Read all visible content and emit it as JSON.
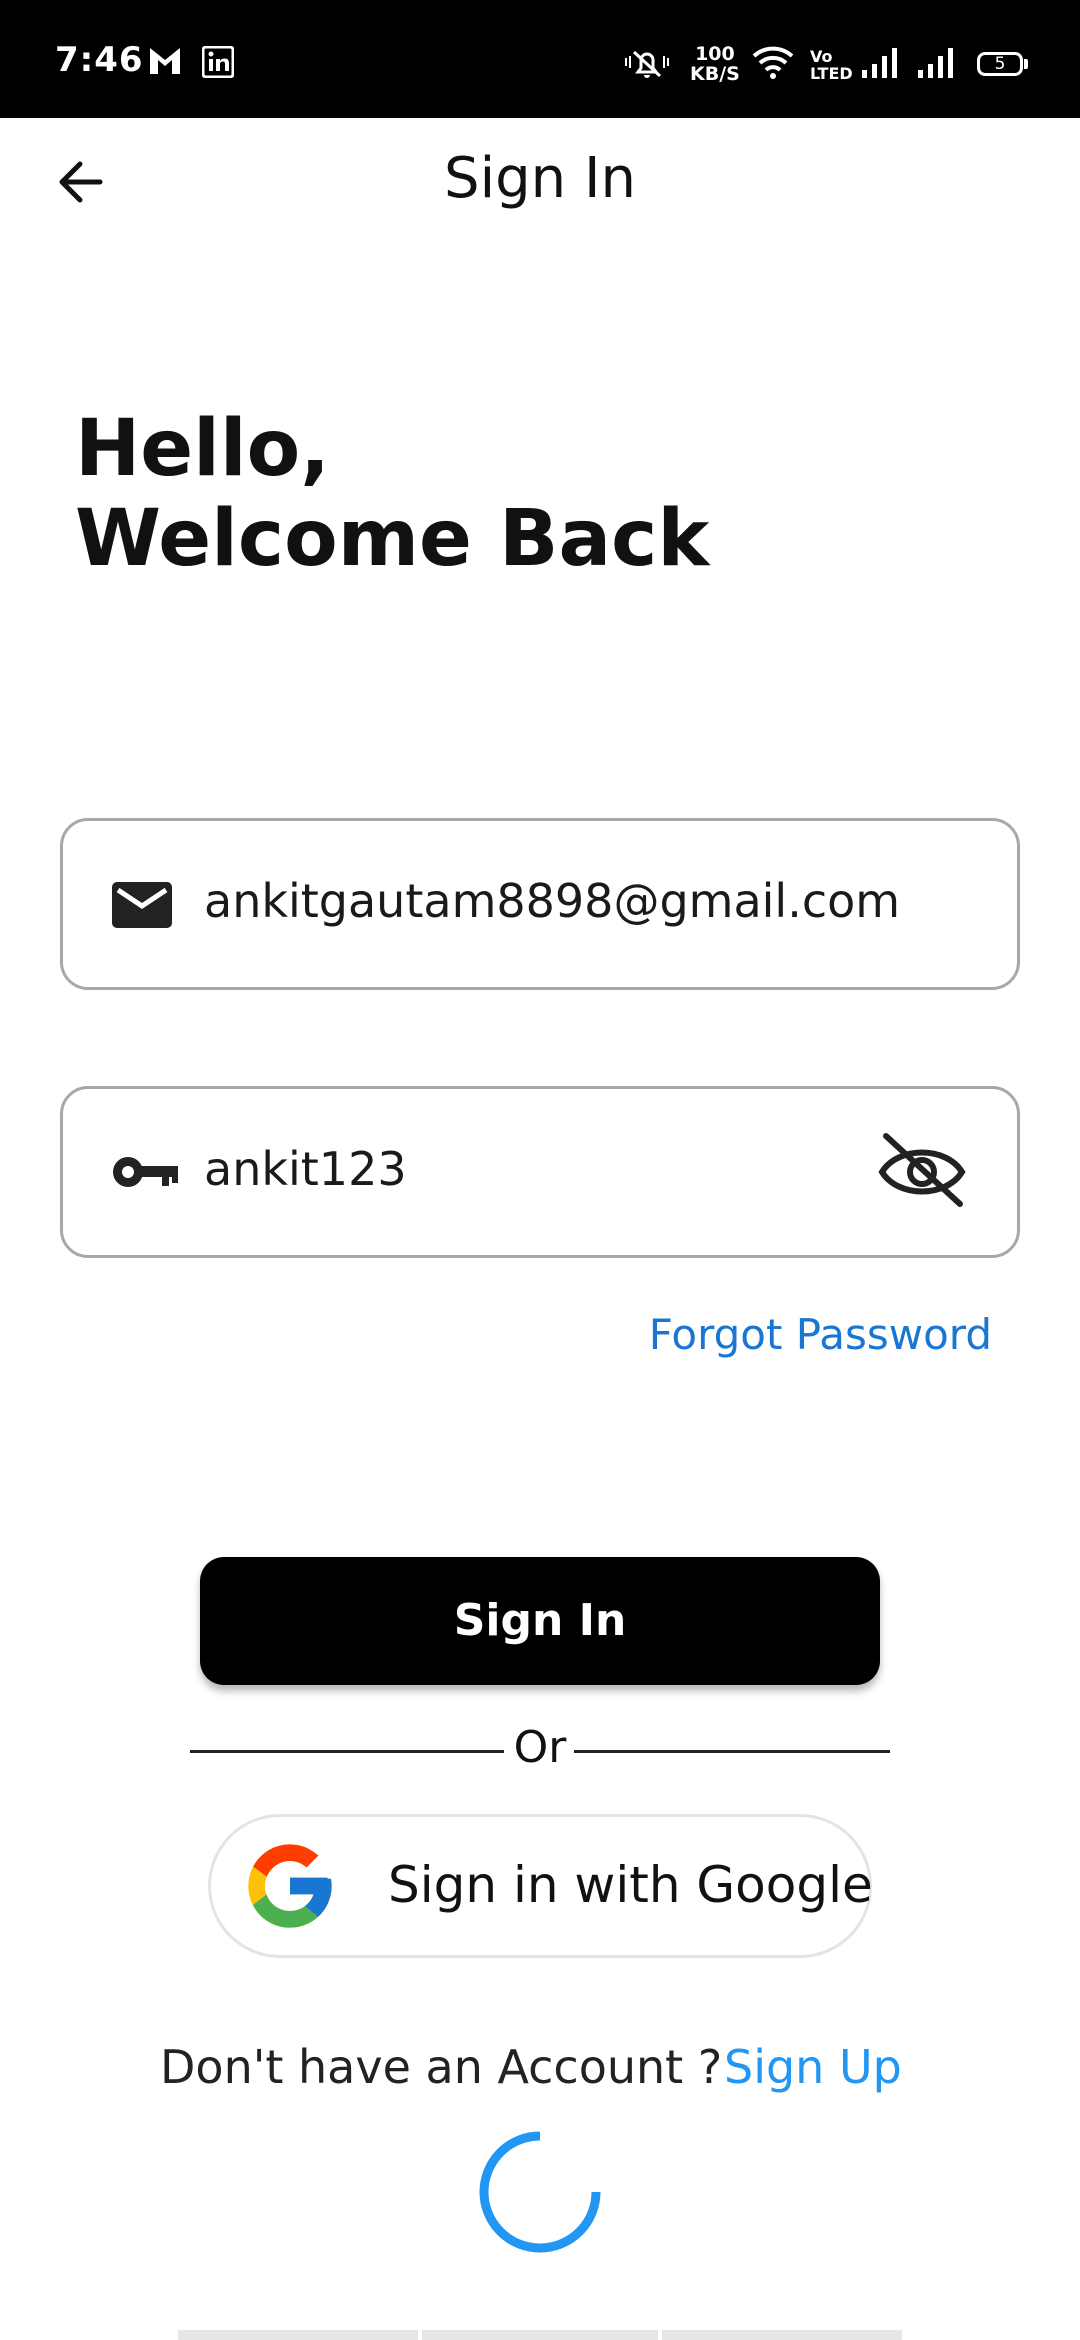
{
  "status_bar": {
    "time": "7:46",
    "speed_value": "100",
    "speed_unit": "KB/S",
    "volte_top": "Vo",
    "volte_bottom": "LTED",
    "battery": "5",
    "icons": [
      "gmail-icon",
      "linkedin-icon",
      "mute-icon",
      "wifi-icon",
      "signal-icon",
      "signal-icon",
      "battery-icon"
    ]
  },
  "header": {
    "title": "Sign In"
  },
  "greeting": {
    "line1": "Hello,",
    "line2": "Welcome Back"
  },
  "form": {
    "email_value": "ankitgautam8898@gmail.com",
    "password_value": "ankit123",
    "forgot_label": "Forgot Password",
    "signin_label": "Sign In",
    "or_label": "Or",
    "google_label": "Sign in with Google"
  },
  "footer": {
    "no_account_label": "Don't have an Account ?",
    "signup_label": "Sign Up"
  },
  "colors": {
    "status_bar": "#000000",
    "link_blue": "#1976d2",
    "signup_blue": "#2196f3",
    "primary_button": "#000000",
    "spinner": "#2196f3"
  }
}
